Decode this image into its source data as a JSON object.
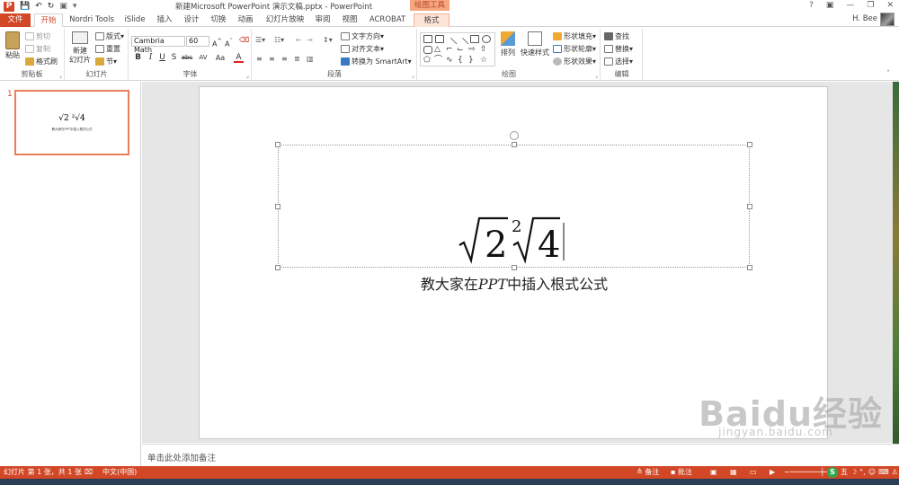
{
  "window": {
    "title": "新建Microsoft PowerPoint 演示文稿.pptx - PowerPoint",
    "context_tool": "绘图工具",
    "user": "H. Bee",
    "controls": [
      "?",
      "▣",
      "—",
      "❐",
      "✕"
    ]
  },
  "tabs": {
    "file": "文件",
    "home": "开始",
    "nordri": "Nordri Tools",
    "islide": "iSlide",
    "insert": "插入",
    "design": "设计",
    "transitions": "切换",
    "animations": "动画",
    "slideshow": "幻灯片放映",
    "review": "审阅",
    "view": "视图",
    "acrobat": "ACROBAT",
    "format": "格式"
  },
  "ribbon": {
    "clipboard": {
      "label": "剪贴板",
      "paste": "粘贴",
      "cut": "剪切",
      "copy": "复制",
      "painter": "格式刷"
    },
    "slides": {
      "label": "幻灯片",
      "new_slide_1": "新建",
      "new_slide_2": "幻灯片",
      "layout": "版式",
      "reset": "重置",
      "section": "节"
    },
    "font": {
      "label": "字体",
      "font_name": "Cambria Math",
      "font_size": "60",
      "bold": "B",
      "italic": "I",
      "underline": "U",
      "shadow": "S",
      "strike": "abc",
      "spacing": "AV",
      "case": "Aa",
      "color": "A"
    },
    "paragraph": {
      "label": "段落",
      "text_direction": "文字方向",
      "align_text": "对齐文本",
      "smartart": "转换为 SmartArt"
    },
    "drawing": {
      "label": "绘图",
      "arrange": "排列",
      "quick_styles": "快速样式",
      "shape_fill": "形状填充",
      "shape_outline": "形状轮廓",
      "shape_effects": "形状效果"
    },
    "editing": {
      "label": "编辑",
      "find": "查找",
      "replace": "替换",
      "select": "选择"
    }
  },
  "thumbnail": {
    "number": "1",
    "formula": "√2 ²√4",
    "caption": "教大家在PPT中插入根式公式"
  },
  "slide": {
    "radical1": "2",
    "index": "2",
    "radical2": "4",
    "caption_before": "教大家在",
    "caption_italic": "PPT",
    "caption_after": "中插入根式公式"
  },
  "notes": {
    "placeholder": "单击此处添加备注"
  },
  "status": {
    "slide_info": "幻灯片 第 1 张，共 1 张",
    "language": "中文(中国)",
    "notes": "备注",
    "comments": "批注"
  },
  "watermark": {
    "main": "Baidu经验",
    "sub": "jingyan.baidu.com"
  },
  "colors": {
    "accent": "#d24726",
    "thumb_border": "#e87e5a"
  }
}
